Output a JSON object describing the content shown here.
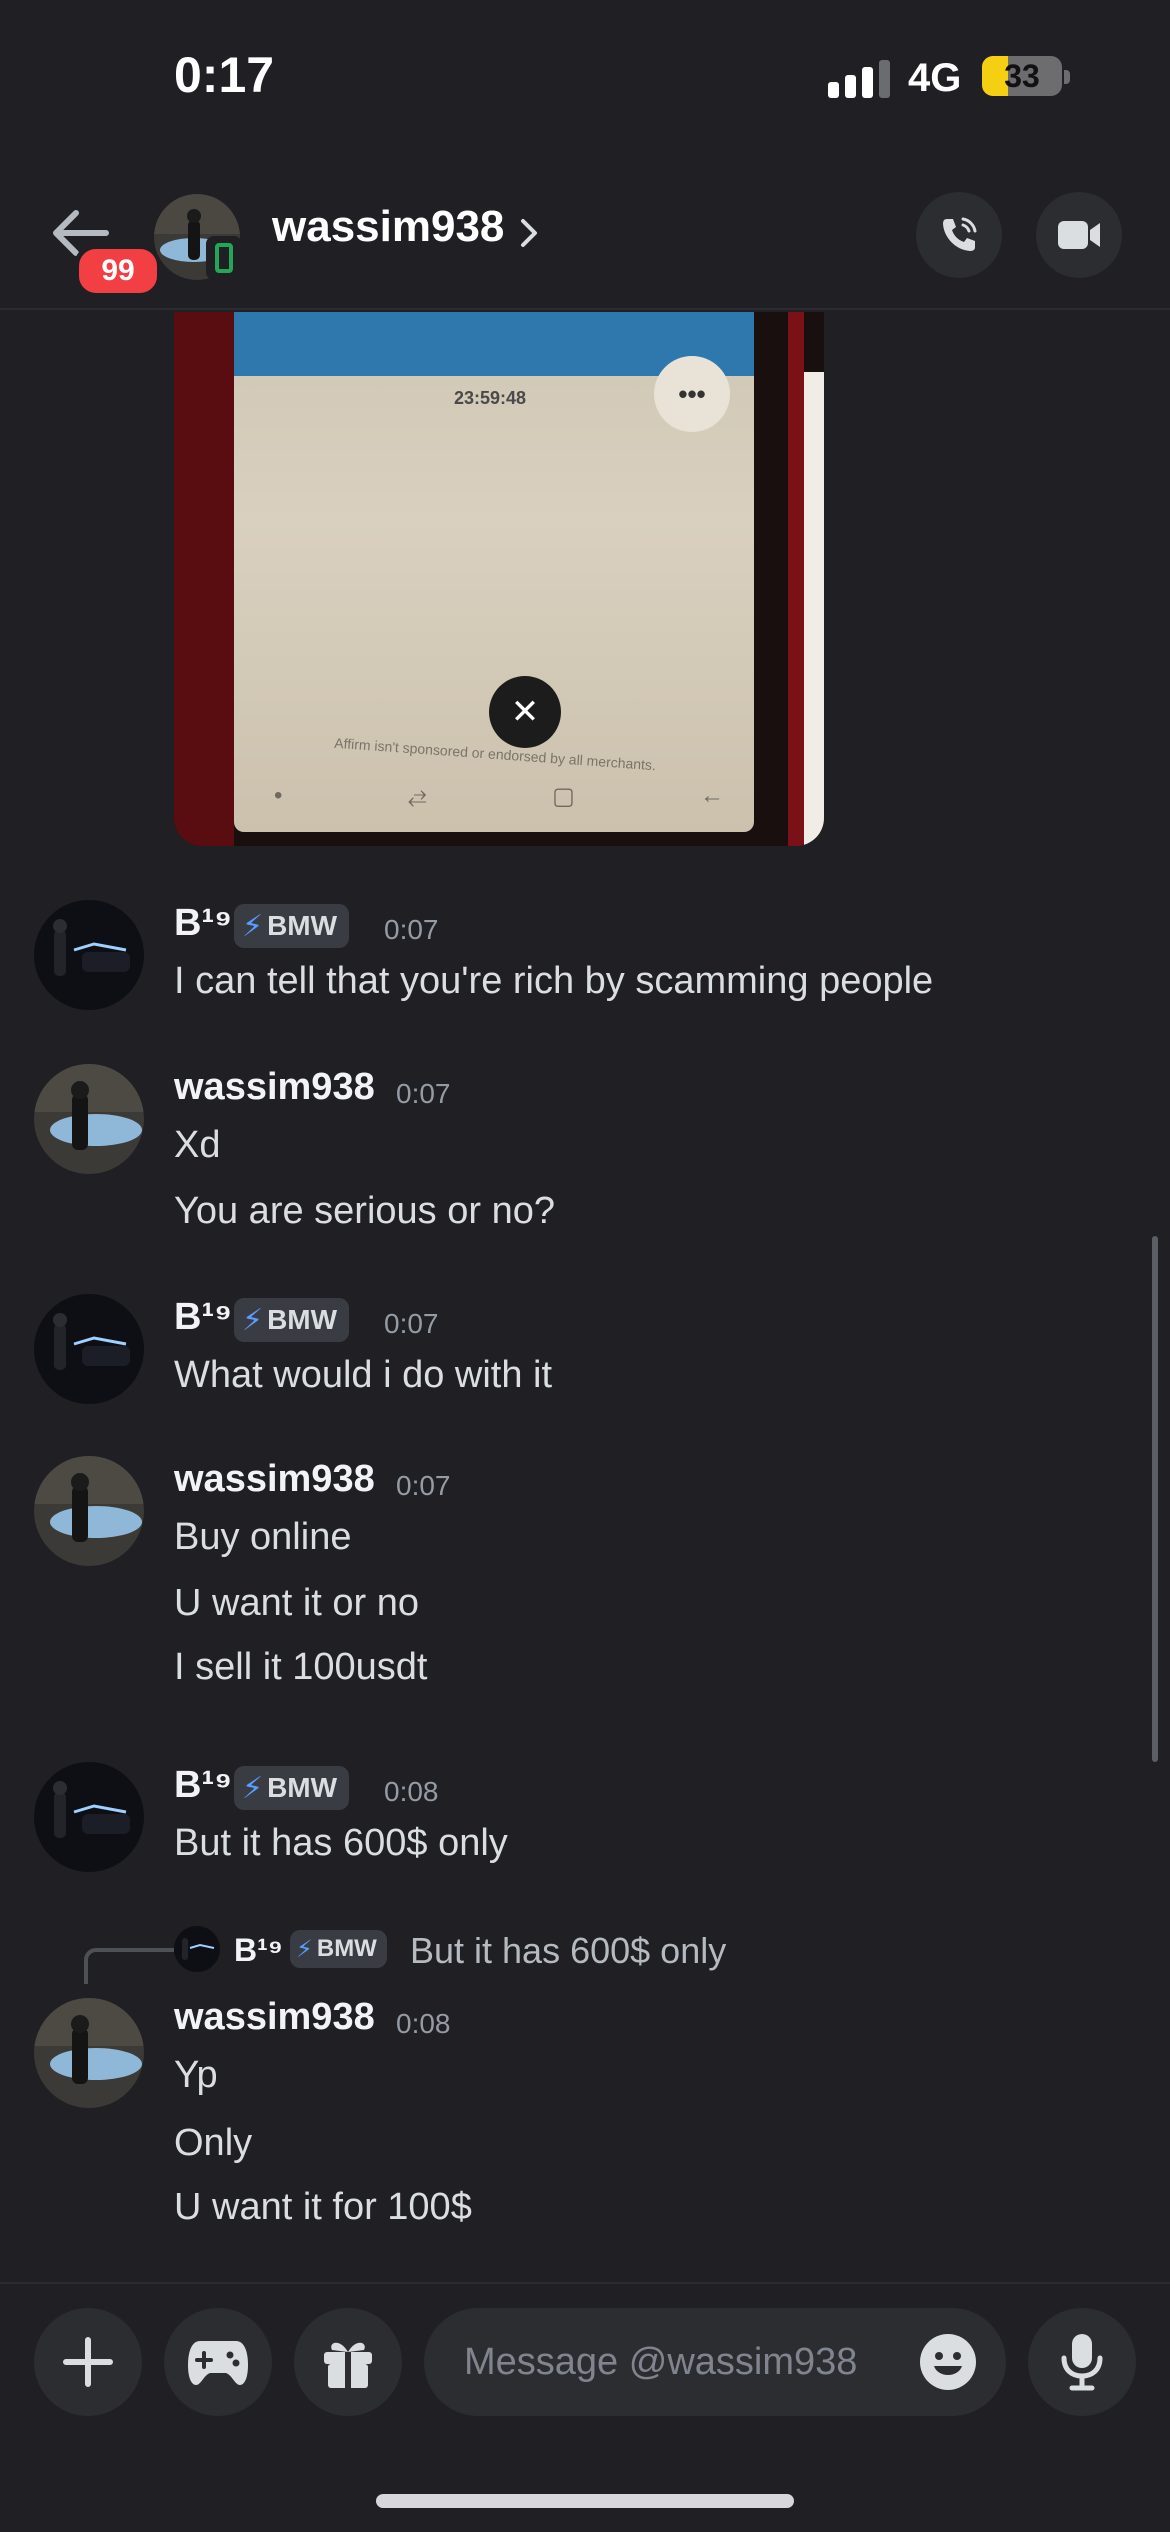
{
  "status_bar": {
    "time": "0:17",
    "network": "4G",
    "battery": "33",
    "battery_level": 0.33,
    "signal_bars": 3
  },
  "header": {
    "back_badge": "99",
    "username": "wassim938"
  },
  "attachment": {
    "timer": "23:59:48",
    "disclaimer": "Affirm isn't sponsored or endorsed by all merchants."
  },
  "messages": [
    {
      "author": "B¹⁹",
      "tag": "BMW",
      "time": "0:07",
      "lines": [
        "I can tell that you're rich by scamming people"
      ]
    },
    {
      "author": "wassim938",
      "time": "0:07",
      "lines": [
        "Xd",
        "You are serious or no?"
      ]
    },
    {
      "author": "B¹⁹",
      "tag": "BMW",
      "time": "0:07",
      "lines": [
        "What would i do with it"
      ]
    },
    {
      "author": "wassim938",
      "time": "0:07",
      "lines": [
        "Buy online",
        "U want it or no",
        "I sell it 100usdt"
      ]
    },
    {
      "author": "B¹⁹",
      "tag": "BMW",
      "time": "0:08",
      "lines": [
        "But it has 600$ only"
      ]
    },
    {
      "author": "wassim938",
      "time": "0:08",
      "lines": [
        "Yp",
        "Only",
        "U want it for 100$"
      ]
    }
  ],
  "reply": {
    "author": "B¹⁹",
    "tag": "BMW",
    "text": "But it has 600$ only"
  },
  "composer": {
    "placeholder": "Message @wassim938",
    "value": ""
  },
  "colors": {
    "background": "#1f1f24",
    "button_bg": "#2b2d31",
    "badge_red": "#f23f43",
    "tag_bolt": "#5a9cff",
    "online_green": "#23a55a"
  },
  "icons": [
    "back-arrow-icon",
    "phone-call-icon",
    "video-camera-icon",
    "plus-icon",
    "gamepad-icon",
    "gift-icon",
    "emoji-icon",
    "microphone-icon",
    "chevron-right-icon",
    "lightning-icon",
    "mobile-icon"
  ]
}
